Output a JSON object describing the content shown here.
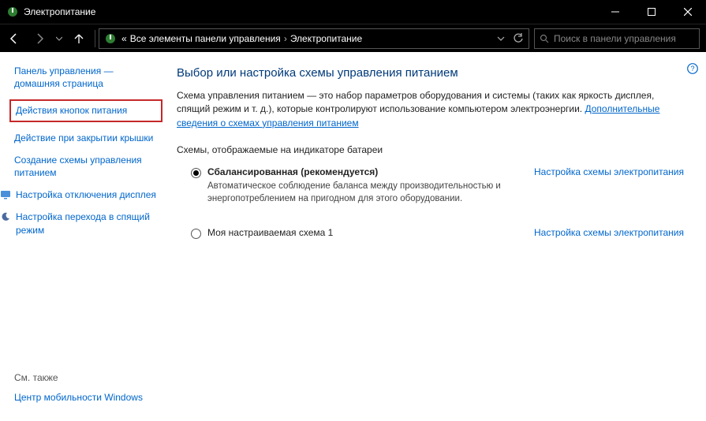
{
  "window": {
    "title": "Электропитание"
  },
  "breadcrumb": {
    "prefix": "«",
    "items": [
      "Все элементы панели управления",
      "Электропитание"
    ],
    "separator": "›"
  },
  "search": {
    "placeholder": "Поиск в панели управления"
  },
  "sidebar": {
    "home": "Панель управления — домашняя страница",
    "items": [
      "Действия кнопок питания",
      "Действие при закрытии крышки",
      "Создание схемы управления питанием",
      "Настройка отключения дисплея",
      "Настройка перехода в спящий режим"
    ],
    "seealso_title": "См. также",
    "seealso": [
      "Центр мобильности Windows"
    ]
  },
  "main": {
    "heading": "Выбор или настройка схемы управления питанием",
    "desc1": "Схема управления питанием — это набор параметров оборудования и системы (таких как яркость дисплея, спящий режим и т. д.), которые контролируют использование компьютером электроэнергии.",
    "more_link": "Дополнительные сведения о схемах управления питанием",
    "section_title": "Схемы, отображаемые на индикаторе батареи",
    "plans": [
      {
        "name": "Сбалансированная (рекомендуется)",
        "selected": true,
        "desc": "Автоматическое соблюдение баланса между производительностью и энергопотреблением на пригодном для этого оборудовании.",
        "link": "Настройка схемы электропитания"
      },
      {
        "name": "Моя настраиваемая схема 1",
        "selected": false,
        "desc": "",
        "link": "Настройка схемы электропитания"
      }
    ]
  }
}
